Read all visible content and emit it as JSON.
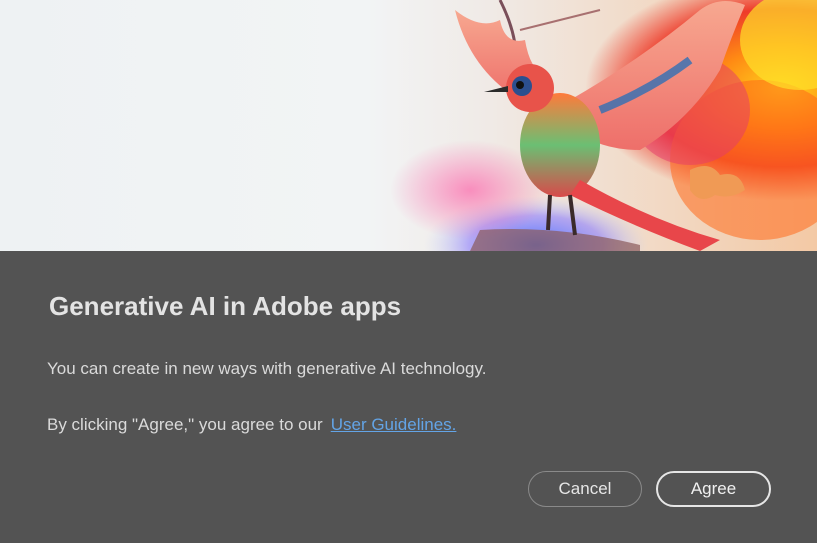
{
  "dialog": {
    "title": "Generative AI in Adobe apps",
    "description": "You can create in new ways with generative AI technology.",
    "consent_prefix": "By clicking \"Agree,\" you agree to our",
    "guidelines_link": "User Guidelines.",
    "cancel_label": "Cancel",
    "agree_label": "Agree"
  },
  "colors": {
    "background": "#535353",
    "title_text": "#e3e3e3",
    "body_text": "#dadada",
    "link": "#63a4e6"
  },
  "icons": {
    "hero": "hummingbird-illustration"
  }
}
